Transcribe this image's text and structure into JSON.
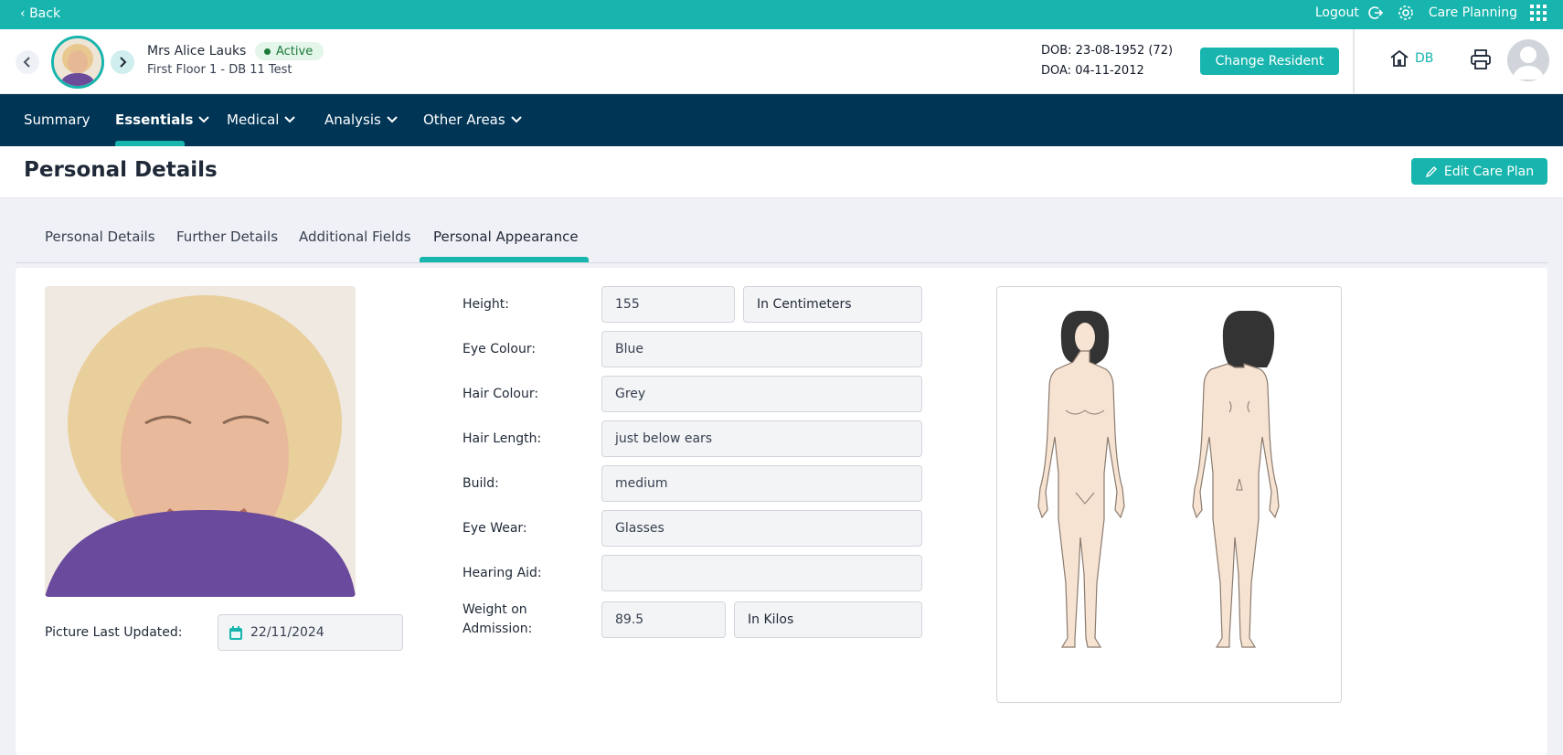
{
  "topbar": {
    "back_label": "Back",
    "logout_label": "Logout",
    "module_label": "Care Planning"
  },
  "resident": {
    "name": "Mrs Alice Lauks",
    "status": "Active",
    "location": "First Floor 1 - DB 11 Test",
    "dob": "DOB: 23-08-1952 (72)",
    "doa": "DOA: 04-11-2012",
    "change_button": "Change Resident",
    "home_label": "DB"
  },
  "nav": {
    "items": [
      {
        "label": "Summary"
      },
      {
        "label": "Essentials"
      },
      {
        "label": "Medical"
      },
      {
        "label": "Analysis"
      },
      {
        "label": "Other Areas"
      }
    ],
    "active": "Essentials"
  },
  "page": {
    "title": "Personal Details",
    "edit_button": "Edit Care Plan"
  },
  "subtabs": {
    "items": [
      "Personal Details",
      "Further Details",
      "Additional Fields",
      "Personal Appearance"
    ],
    "active": "Personal Appearance"
  },
  "photo": {
    "last_updated_label": "Picture Last Updated:",
    "last_updated_value": "22/11/2024"
  },
  "fields": {
    "height": {
      "label": "Height:",
      "value": "155",
      "unit": "In Centimeters"
    },
    "eye_colour": {
      "label": "Eye Colour:",
      "value": "Blue"
    },
    "hair_colour": {
      "label": "Hair Colour:",
      "value": "Grey"
    },
    "hair_length": {
      "label": "Hair Length:",
      "value": "just below ears"
    },
    "build": {
      "label": "Build:",
      "value": "medium"
    },
    "eye_wear": {
      "label": "Eye Wear:",
      "value": "Glasses"
    },
    "hearing_aid": {
      "label": "Hearing Aid:",
      "value": ""
    },
    "weight": {
      "label_line1": "Weight on",
      "label_line2": "Admission:",
      "value": "89.5",
      "unit": "In Kilos"
    }
  },
  "colors": {
    "accent": "#17b5ad",
    "nav_bg": "#003556",
    "status_green": "#1b7a3a"
  }
}
